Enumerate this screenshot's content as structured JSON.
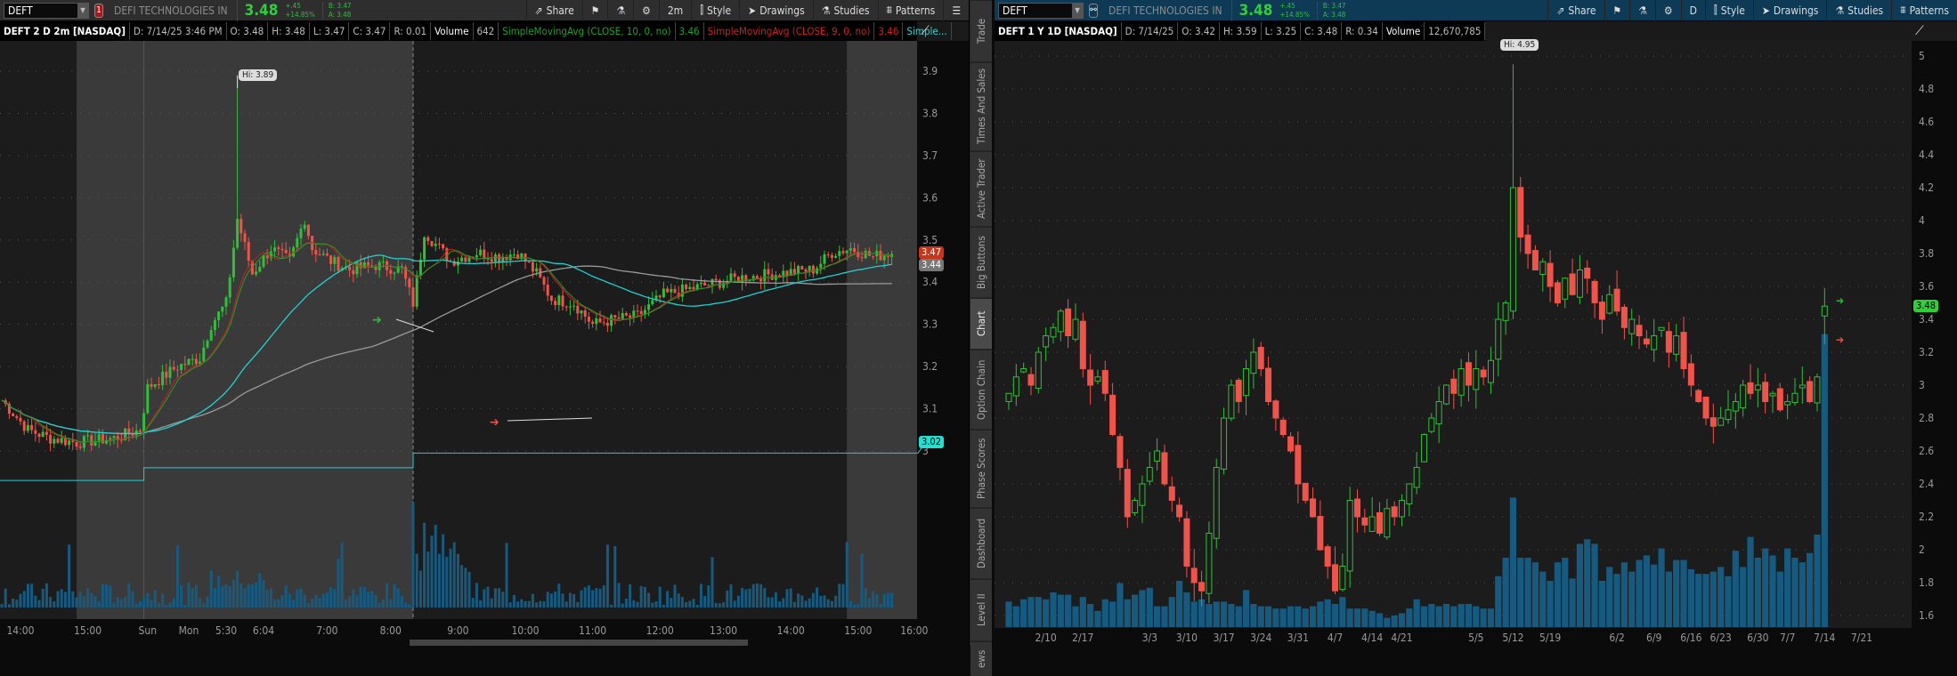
{
  "left": {
    "symbol": "DEFT",
    "link_num": "1",
    "company": "DEFI TECHNOLOGIES IN",
    "last": "3.48",
    "change": "+.45",
    "change_pct": "+14.85%",
    "bid": "B: 3.47",
    "ask": "A: 3.48",
    "toolbar": {
      "share": "Share",
      "period": "2m",
      "style": "Style",
      "drawings": "Drawings",
      "studies": "Studies",
      "patterns": "Patterns"
    },
    "info": {
      "title": "DEFT 2 D 2m [NASDAQ]",
      "date": "D: 7/14/25 3:46 PM",
      "open": "O: 3.48",
      "high": "H: 3.48",
      "low": "L: 3.47",
      "close": "C: 3.47",
      "range": "R: 0.01",
      "volume_label": "Volume",
      "volume": "642",
      "sma1": "SimpleMovingAvg (CLOSE, 10, 0, no)",
      "sma1_val": "3.46",
      "sma2": "SimpleMovingAvg (CLOSE, 9, 0, no)",
      "sma2_val": "3.46",
      "sma3": "Simple..."
    },
    "hi_label": "Hi: 3.89",
    "price_boxes": [
      {
        "text": "3.47",
        "price": 3.47,
        "color": "#c8361a"
      },
      {
        "text": "3.44",
        "price": 3.44,
        "color": "#777777"
      },
      {
        "text": "3.02",
        "price": 3.02,
        "color": "#22e0cf"
      }
    ],
    "y_ticks": [
      "3.9",
      "3.8",
      "3.7",
      "3.6",
      "3.5",
      "3.4",
      "3.3",
      "3.2",
      "3.1",
      "3"
    ],
    "time_labels": [
      {
        "t": "14:00",
        "bar": 5
      },
      {
        "t": "15:00",
        "bar": 23
      },
      {
        "t": "Sun",
        "bar": 39
      },
      {
        "t": "Mon",
        "bar": 50
      },
      {
        "t": "5:30",
        "bar": 60
      },
      {
        "t": "6:04",
        "bar": 70
      },
      {
        "t": "7:00",
        "bar": 87
      },
      {
        "t": "8:00",
        "bar": 104
      },
      {
        "t": "9:00",
        "bar": 122
      },
      {
        "t": "10:00",
        "bar": 140
      },
      {
        "t": "11:00",
        "bar": 158
      },
      {
        "t": "12:00",
        "bar": 176
      },
      {
        "t": "13:00",
        "bar": 193
      },
      {
        "t": "14:00",
        "bar": 211
      },
      {
        "t": "15:00",
        "bar": 229
      },
      {
        "t": "16:00",
        "bar": 244
      }
    ],
    "price_keypoints": [
      [
        0,
        3.12
      ],
      [
        7,
        3.05
      ],
      [
        13,
        3.03
      ],
      [
        20,
        3.02
      ],
      [
        30,
        3.03
      ],
      [
        37,
        3.05
      ],
      [
        39,
        3.15
      ],
      [
        47,
        3.2
      ],
      [
        53,
        3.22
      ],
      [
        56,
        3.3
      ],
      [
        60,
        3.35
      ],
      [
        63,
        3.55
      ],
      [
        67,
        3.42
      ],
      [
        72,
        3.48
      ],
      [
        77,
        3.45
      ],
      [
        81,
        3.55
      ],
      [
        83,
        3.48
      ],
      [
        88,
        3.45
      ],
      [
        93,
        3.43
      ],
      [
        100,
        3.44
      ],
      [
        107,
        3.43
      ],
      [
        110,
        3.35
      ],
      [
        113,
        3.52
      ],
      [
        120,
        3.45
      ],
      [
        127,
        3.47
      ],
      [
        133,
        3.46
      ],
      [
        138,
        3.47
      ],
      [
        143,
        3.42
      ],
      [
        147,
        3.36
      ],
      [
        153,
        3.35
      ],
      [
        158,
        3.3
      ],
      [
        163,
        3.31
      ],
      [
        170,
        3.32
      ],
      [
        177,
        3.37
      ],
      [
        187,
        3.39
      ],
      [
        197,
        3.41
      ],
      [
        207,
        3.42
      ],
      [
        217,
        3.43
      ],
      [
        222,
        3.47
      ],
      [
        227,
        3.48
      ],
      [
        233,
        3.46
      ],
      [
        238,
        3.47
      ]
    ],
    "hi_bar": 63,
    "hi_price": 3.89
  },
  "right": {
    "symbol": "DEFT",
    "company": "DEFI TECHNOLOGIES IN",
    "last": "3.48",
    "change": "+.45",
    "change_pct": "+14.85%",
    "bid": "B: 3.47",
    "ask": "A: 3.48",
    "toolbar": {
      "share": "Share",
      "period": "D",
      "style": "Style",
      "drawings": "Drawings",
      "studies": "Studies",
      "patterns": "Patterns"
    },
    "info": {
      "title": "DEFT 1 Y 1D [NASDAQ]",
      "date": "D: 7/14/25",
      "open": "O: 3.42",
      "high": "H: 3.59",
      "low": "L: 3.25",
      "close": "C: 3.48",
      "range": "R: 0.34",
      "volume_label": "Volume",
      "volume": "12,670,785"
    },
    "hi_label": "Hi: 4.95",
    "price_box": {
      "text": "3.48",
      "price": 3.48,
      "color": "#2fcf3a"
    },
    "y_ticks": [
      "5",
      "4.8",
      "4.6",
      "4.4",
      "4.2",
      "4",
      "3.8",
      "3.6",
      "3.4",
      "3.2",
      "3",
      "2.8",
      "2.6",
      "2.4",
      "2.2",
      "2",
      "1.8",
      "1.6"
    ],
    "date_labels": [
      {
        "t": "2/10",
        "bar": 5
      },
      {
        "t": "2/17",
        "bar": 10
      },
      {
        "t": "3/3",
        "bar": 19
      },
      {
        "t": "3/10",
        "bar": 24
      },
      {
        "t": "3/17",
        "bar": 29
      },
      {
        "t": "3/24",
        "bar": 34
      },
      {
        "t": "3/31",
        "bar": 39
      },
      {
        "t": "4/7",
        "bar": 44
      },
      {
        "t": "4/14",
        "bar": 49
      },
      {
        "t": "4/21",
        "bar": 53
      },
      {
        "t": "5/5",
        "bar": 63
      },
      {
        "t": "5/12",
        "bar": 68
      },
      {
        "t": "5/19",
        "bar": 73
      },
      {
        "t": "6/2",
        "bar": 82
      },
      {
        "t": "6/9",
        "bar": 87
      },
      {
        "t": "6/16",
        "bar": 92
      },
      {
        "t": "6/23",
        "bar": 96
      },
      {
        "t": "6/30",
        "bar": 101
      },
      {
        "t": "7/7",
        "bar": 105
      },
      {
        "t": "7/14",
        "bar": 110
      },
      {
        "t": "7/21",
        "bar": 115
      }
    ],
    "closes": [
      2.95,
      3.05,
      3.1,
      3.0,
      3.2,
      3.3,
      3.35,
      3.45,
      3.3,
      3.4,
      3.1,
      3.0,
      3.05,
      2.95,
      2.7,
      2.5,
      2.2,
      2.3,
      2.4,
      2.5,
      2.6,
      2.4,
      2.3,
      2.2,
      1.9,
      1.8,
      1.75,
      2.1,
      2.5,
      2.8,
      3.0,
      2.9,
      3.1,
      3.2,
      3.1,
      2.9,
      2.8,
      2.7,
      2.6,
      2.4,
      2.3,
      2.2,
      2.0,
      1.9,
      1.75,
      1.9,
      2.3,
      2.2,
      2.15,
      2.2,
      2.1,
      2.25,
      2.2,
      2.3,
      2.4,
      2.5,
      2.7,
      2.8,
      2.9,
      3.0,
      2.95,
      3.1,
      3.0,
      3.1,
      3.05,
      3.15,
      3.4,
      3.5,
      4.2,
      3.9,
      3.8,
      3.7,
      3.75,
      3.6,
      3.5,
      3.65,
      3.55,
      3.7,
      3.65,
      3.5,
      3.4,
      3.55,
      3.45,
      3.35,
      3.4,
      3.3,
      3.25,
      3.3,
      3.35,
      3.2,
      3.3,
      3.1,
      3.0,
      2.9,
      2.8,
      2.75,
      2.8,
      2.85,
      2.9,
      3.0,
      2.95,
      3.0,
      2.9,
      2.95,
      2.85,
      2.9,
      2.95,
      3.0,
      2.9,
      3.05,
      3.48
    ],
    "volumes_m": [
      1.1,
      0.9,
      1.2,
      1.3,
      1.3,
      1.2,
      1.5,
      1.4,
      1.4,
      0.9,
      1.3,
      1.0,
      0.7,
      1.2,
      1.1,
      1.9,
      1.2,
      1.4,
      1.6,
      1.7,
      0.9,
      0.9,
      1.3,
      2.0,
      1.5,
      1.1,
      1.2,
      1.0,
      1.1,
      1.1,
      1.0,
      0.9,
      1.6,
      1.0,
      0.9,
      0.9,
      0.8,
      0.8,
      0.9,
      0.9,
      0.8,
      0.9,
      1.1,
      1.2,
      1.0,
      1.3,
      0.8,
      0.8,
      0.8,
      0.7,
      0.6,
      0.4,
      0.5,
      0.6,
      0.8,
      1.2,
      0.9,
      1.0,
      0.9,
      1.0,
      0.9,
      1.0,
      1.0,
      0.9,
      0.8,
      0.8,
      2.2,
      3.0,
      5.6,
      3.0,
      3.0,
      2.8,
      2.4,
      2.0,
      2.8,
      3.0,
      2.1,
      3.6,
      3.8,
      3.6,
      2.0,
      2.6,
      2.3,
      2.8,
      2.4,
      2.9,
      3.1,
      2.7,
      3.4,
      2.4,
      2.9,
      2.9,
      2.5,
      2.3,
      2.3,
      2.4,
      2.6,
      2.2,
      3.3,
      2.6,
      3.9,
      3.0,
      3.4,
      3.1,
      2.4,
      3.4,
      3.0,
      2.8,
      3.2,
      4.0,
      12.67
    ],
    "ohlc_overrides": {
      "68": {
        "o": 3.45,
        "h": 4.95,
        "l": 3.4,
        "c": 4.2
      },
      "110": {
        "o": 3.42,
        "h": 3.59,
        "l": 3.25,
        "c": 3.48
      }
    }
  },
  "tabs": [
    "Trade",
    "Times And Sales",
    "Active Trader",
    "Big Buttons",
    "Chart",
    "Option Chain",
    "Phase Scores",
    "Dashboard",
    "Level II",
    "ews"
  ],
  "active_tab": "Chart",
  "colors": {
    "up": "#2fbf3a",
    "down": "#f2524a",
    "volume": "#175a80",
    "sma_fast": "#1fa02a",
    "sma_red": "#d01e1e",
    "sma_cyan": "#22d0d0",
    "sma_gray": "#9a9a9a"
  }
}
